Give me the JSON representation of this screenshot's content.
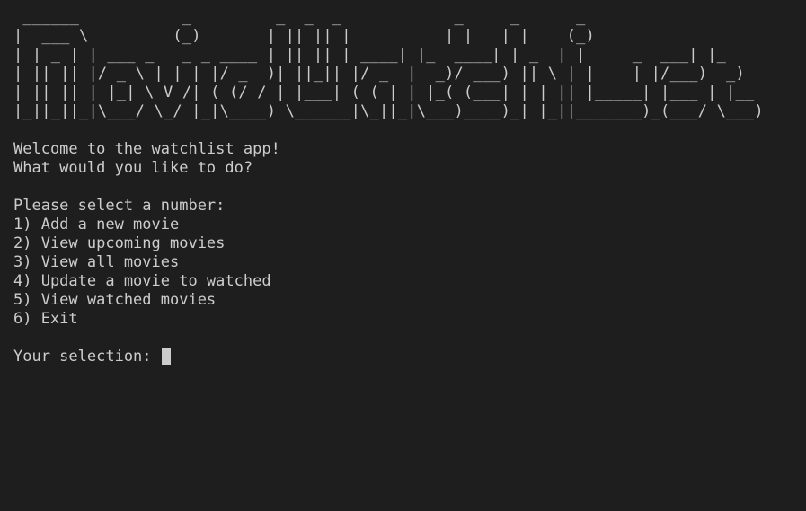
{
  "colors": {
    "background": "#1e1e1e",
    "text": "#cccccc",
    "cursor": "#cccccc"
  },
  "banner": {
    "lines": [
      " ______           _         _  _  _            _     _      _",
      "|  ___ \\         (_)       | || || |          | |   | |    (_)",
      "| | _ | | ___ _   _ _ ____ | || || | ____| |_  ____| | _  | |     _  ___| |_",
      "| || || |/ _ \\ | | | |/ _  )| ||_|| |/ _  |  _)/ ___) || \\ | |    | |/___)  _)",
      "| || || | |_| \\ V /| ( (/ / | |___| ( ( | | |_( (___| | | || |_____| |___ | |__",
      "|_||_||_|\\___/ \\_/ |_|\\____) \\______|\\_||_|\\___)____)_| |_||_______)_(___/ \\___)"
    ]
  },
  "intro": {
    "welcome": "Welcome to the watchlist app!",
    "question": "What would you like to do?"
  },
  "menu": {
    "prompt": "Please select a number:",
    "options": [
      "1) Add a new movie",
      "2) View upcoming movies",
      "3) View all movies",
      "4) Update a movie to watched",
      "5) View watched movies",
      "6) Exit"
    ]
  },
  "input": {
    "label": "Your selection: ",
    "value": ""
  }
}
